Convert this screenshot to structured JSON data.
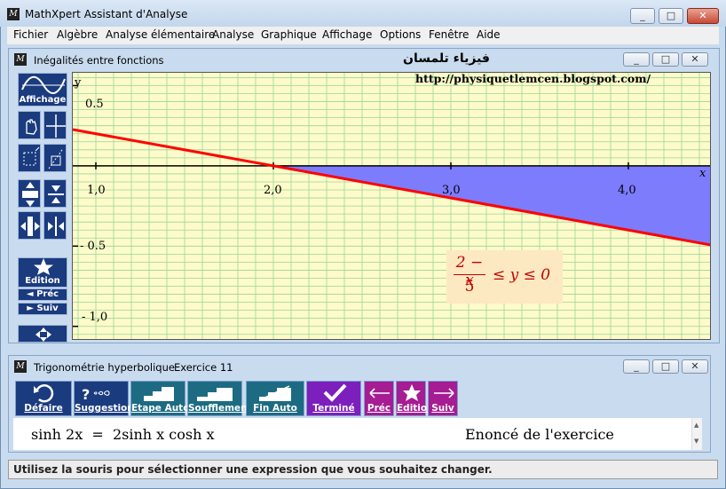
{
  "app": {
    "title": "MathXpert Assistant d'Analyse",
    "icon": "mathxpert-logo"
  },
  "window_buttons": {
    "minimize": "_",
    "maximize": "□",
    "close": "✕"
  },
  "menu": [
    "Fichier",
    "Algèbre",
    "Analyse élémentaire",
    "Analyse",
    "Graphique",
    "Affichage",
    "Options",
    "Fenêtre",
    "Aide"
  ],
  "graph_window": {
    "title": "Inégalités entre fonctions",
    "watermark_arabic": "فيزياء تلمسان",
    "watermark_url": "http://physiquetlemcen.blogspot.com/",
    "tools": {
      "affichage": "Affichage",
      "edition": "Edition",
      "prec": "◄ Préc",
      "suiv": "► Suiv"
    },
    "formula": {
      "numerator": "2 − x",
      "denominator": "5",
      "rest": "≤ y ≤ 0"
    }
  },
  "chart_data": {
    "type": "line",
    "title": "",
    "xlabel": "x",
    "ylabel": "y",
    "xlim": [
      0.87,
      4.47
    ],
    "ylim": [
      -1.09,
      0.58
    ],
    "x_ticks": [
      1.0,
      2.0,
      3.0,
      4.0
    ],
    "x_tick_labels": [
      "1,0",
      "2,0",
      "3,0",
      "4,0"
    ],
    "y_ticks": [
      0.5,
      -0.5,
      -1.0
    ],
    "y_tick_labels": [
      "0.5",
      "- 0.5",
      "- 1,0"
    ],
    "grid": true,
    "series": [
      {
        "name": "",
        "x": [
          0.87,
          4.47
        ],
        "y": [
          0.226,
          -0.494
        ],
        "color": "#ff0000"
      }
    ],
    "shaded_region": {
      "description_color": "#7c7cfc",
      "from_x": 2.0,
      "to_x": 4.47
    }
  },
  "exercise_window": {
    "title": "Trigonométrie hyperbolique",
    "exercise": "Exercice 11",
    "buttons": [
      "Défaire",
      "Suggestion",
      "Etape Auto",
      "Soufflement",
      "Fin Auto",
      "Terminé",
      "Préc",
      "Edition",
      "Suiv"
    ],
    "expression": "sinh 2x  =  2sinh x cosh x",
    "label": "Enoncé de l'exercice"
  },
  "status": "Utilisez la souris pour sélectionner une expression que vous souhaitez changer.",
  "colors": {
    "curve": "#ff0000",
    "shade": "#7c7cfc",
    "plot_bg": "#fdfbc9",
    "grid": "#9ad69a",
    "button_dark": "#1b3b7f"
  }
}
